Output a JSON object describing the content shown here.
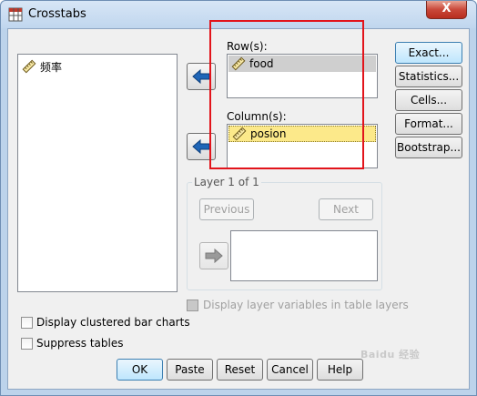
{
  "window": {
    "title": "Crosstabs",
    "close_glyph": "X"
  },
  "source_list": {
    "items": [
      {
        "label": "频率",
        "icon": "ruler-icon"
      }
    ]
  },
  "rows": {
    "label": "Row(s):",
    "items": [
      {
        "label": "food",
        "icon": "ruler-icon",
        "selected": true
      }
    ]
  },
  "columns": {
    "label": "Column(s):",
    "items": [
      {
        "label": "posion",
        "icon": "ruler-icon",
        "highlighted": true
      }
    ]
  },
  "layer": {
    "title": "Layer 1 of 1",
    "previous": "Previous",
    "next": "Next"
  },
  "side_buttons": {
    "exact": "Exact...",
    "statistics": "Statistics...",
    "cells": "Cells...",
    "format": "Format...",
    "bootstrap": "Bootstrap..."
  },
  "options": {
    "display_layer": "Display layer variables in table layers",
    "clustered_bar": "Display clustered bar charts",
    "suppress_tables": "Suppress tables"
  },
  "buttons": {
    "ok": "OK",
    "paste": "Paste",
    "reset": "Reset",
    "cancel": "Cancel",
    "help": "Help"
  },
  "watermark": "Baidu 经验",
  "colors": {
    "accent_blue": "#3c7fb1",
    "highlight_yellow": "#fce98a",
    "selected_gray": "#cfcfcf",
    "annotation_red": "#e2141b"
  }
}
